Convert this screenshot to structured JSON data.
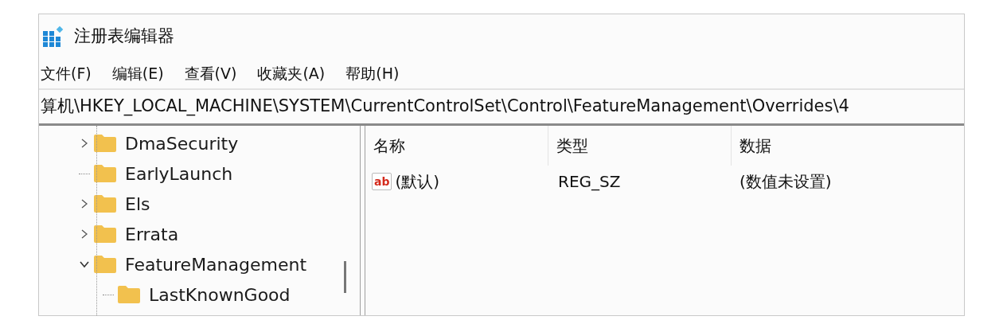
{
  "window": {
    "title": "注册表编辑器"
  },
  "menu": [
    {
      "label": "文件(F)"
    },
    {
      "label": "编辑(E)"
    },
    {
      "label": "查看(V)"
    },
    {
      "label": "收藏夹(A)"
    },
    {
      "label": "帮助(H)"
    }
  ],
  "address": {
    "value": "算机\\HKEY_LOCAL_MACHINE\\SYSTEM\\CurrentControlSet\\Control\\FeatureManagement\\Overrides\\4"
  },
  "tree": [
    {
      "kind": "node",
      "label": "DmaSecurity",
      "expanded": false
    },
    {
      "kind": "leaf",
      "label": "EarlyLaunch"
    },
    {
      "kind": "node",
      "label": "Els",
      "expanded": false
    },
    {
      "kind": "node",
      "label": "Errata",
      "expanded": false
    },
    {
      "kind": "node",
      "label": "FeatureManagement",
      "expanded": true,
      "children": [
        {
          "kind": "leaf",
          "label": "LastKnownGood"
        }
      ]
    }
  ],
  "table": {
    "columns": [
      "名称",
      "类型",
      "数据"
    ],
    "rows": [
      {
        "icon_text": "ab",
        "name": "(默认)",
        "type": "REG_SZ",
        "data": "(数值未设置)"
      }
    ]
  }
}
